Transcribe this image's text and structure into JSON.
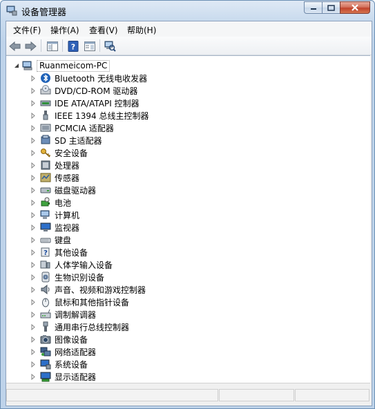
{
  "window": {
    "title": "设备管理器"
  },
  "menu": [
    "文件(F)",
    "操作(A)",
    "查看(V)",
    "帮助(H)"
  ],
  "toolbar": [
    "back-icon",
    "forward-icon",
    "show-hide-console-tree-icon",
    "help-icon",
    "properties-icon",
    "scan-hardware-icon"
  ],
  "tree": {
    "root": "Ruanmeicom-PC",
    "items": [
      {
        "label": "Bluetooth 无线电收发器",
        "icon": "bluetooth-icon"
      },
      {
        "label": "DVD/CD-ROM 驱动器",
        "icon": "dvd-drive-icon"
      },
      {
        "label": "IDE ATA/ATAPI 控制器",
        "icon": "ide-controller-icon"
      },
      {
        "label": "IEEE 1394 总线主控制器",
        "icon": "ieee1394-icon"
      },
      {
        "label": "PCMCIA 适配器",
        "icon": "pcmcia-icon"
      },
      {
        "label": "SD 主适配器",
        "icon": "sd-adapter-icon"
      },
      {
        "label": "安全设备",
        "icon": "key-icon"
      },
      {
        "label": "处理器",
        "icon": "processor-icon"
      },
      {
        "label": "传感器",
        "icon": "sensor-icon"
      },
      {
        "label": "磁盘驱动器",
        "icon": "disk-drive-icon"
      },
      {
        "label": "电池",
        "icon": "battery-icon"
      },
      {
        "label": "计算机",
        "icon": "computer-icon"
      },
      {
        "label": "监视器",
        "icon": "monitor-icon"
      },
      {
        "label": "键盘",
        "icon": "keyboard-icon"
      },
      {
        "label": "其他设备",
        "icon": "unknown-device-icon"
      },
      {
        "label": "人体学输入设备",
        "icon": "hid-icon"
      },
      {
        "label": "生物识别设备",
        "icon": "fingerprint-icon"
      },
      {
        "label": "声音、视频和游戏控制器",
        "icon": "speaker-icon"
      },
      {
        "label": "鼠标和其他指针设备",
        "icon": "mouse-icon"
      },
      {
        "label": "调制解调器",
        "icon": "modem-icon"
      },
      {
        "label": "通用串行总线控制器",
        "icon": "usb-icon"
      },
      {
        "label": "图像设备",
        "icon": "camera-icon"
      },
      {
        "label": "网络适配器",
        "icon": "network-adapter-icon"
      },
      {
        "label": "系统设备",
        "icon": "system-device-icon"
      },
      {
        "label": "显示适配器",
        "icon": "display-adapter-icon"
      }
    ]
  }
}
